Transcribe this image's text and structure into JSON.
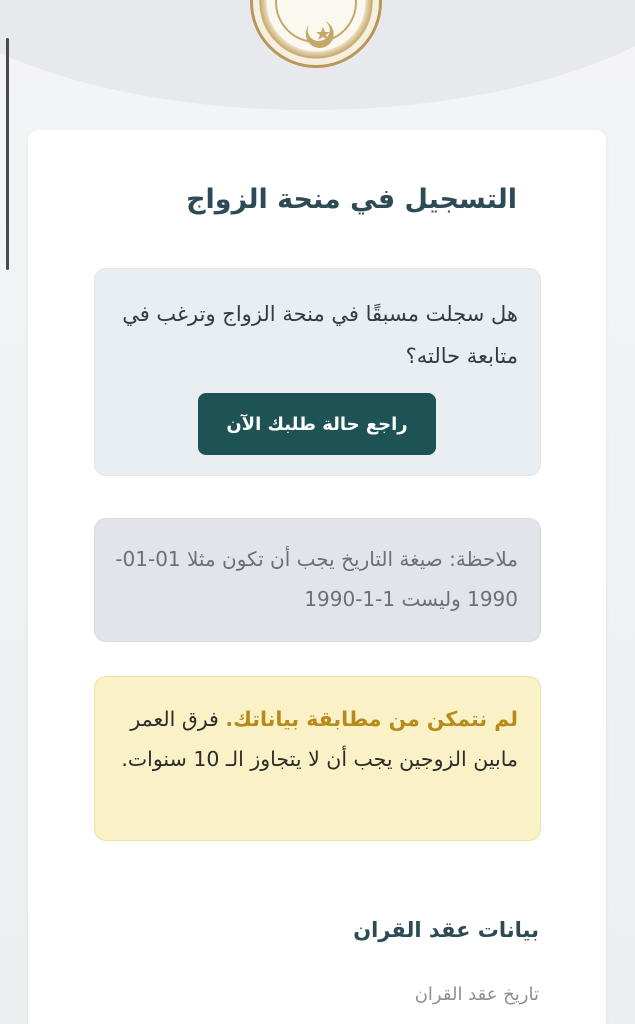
{
  "page": {
    "title": "التسجيل في منحة الزواج"
  },
  "followup": {
    "question": "هل سجلت مسبقًا في منحة الزواج وترغب في متابعة حالته؟",
    "button_label": "راجع حالة طلبك الآن"
  },
  "note": {
    "text": "ملاحظة: صيغة التاريخ يجب أن تكون مثلا 01-01-1990 وليست 1-1-1990"
  },
  "warning": {
    "highlight": "لم نتمكن من مطابقة بياناتك.",
    "text": "فرق العمر مابين الزوجين يجب أن لا يتجاوز الـ 10 سنوات."
  },
  "marriage_contract": {
    "section_title": "بيانات عقد القران",
    "date_label": "تاريخ عقد القران"
  },
  "colors": {
    "primary": "#1d5354",
    "heading": "#2d4b55",
    "warning_bg": "#faf2c6",
    "warning_accent": "#b88a1c",
    "info_bg": "#e9eef2",
    "note_bg": "#e3e4e9"
  },
  "icons": {
    "logo": "government-emblem-logo"
  }
}
